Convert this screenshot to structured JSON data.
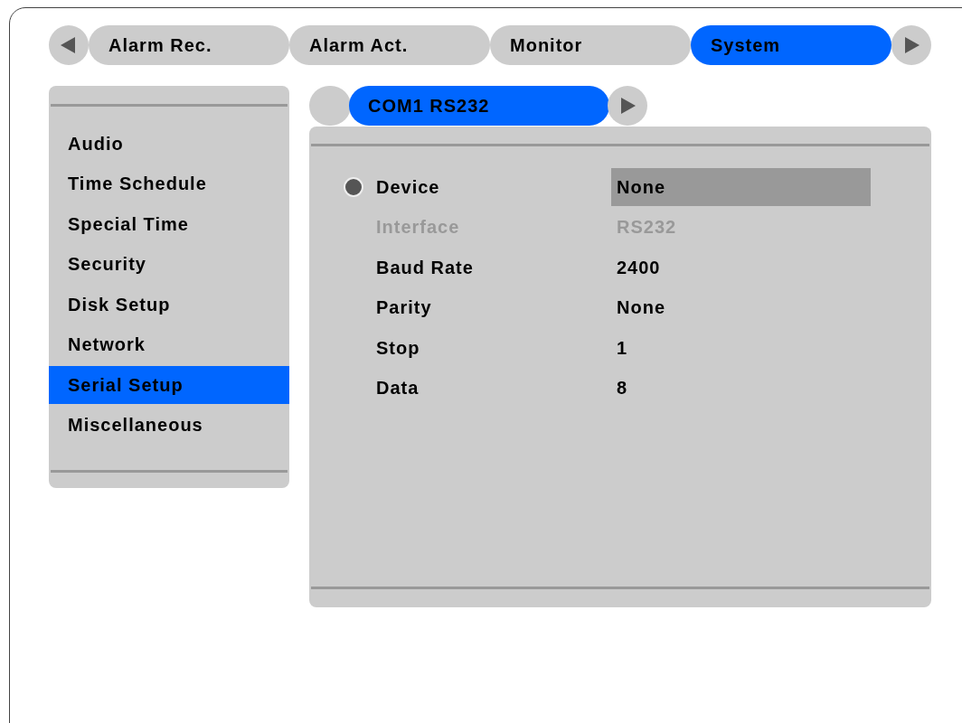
{
  "tabs": [
    {
      "label": "Alarm Rec.",
      "selected": false
    },
    {
      "label": "Alarm Act.",
      "selected": false
    },
    {
      "label": "Monitor",
      "selected": false
    },
    {
      "label": "System",
      "selected": true
    }
  ],
  "sidebar": {
    "items": [
      {
        "label": "Audio",
        "selected": false
      },
      {
        "label": "Time Schedule",
        "selected": false
      },
      {
        "label": "Special Time",
        "selected": false
      },
      {
        "label": "Security",
        "selected": false
      },
      {
        "label": "Disk Setup",
        "selected": false
      },
      {
        "label": "Network",
        "selected": false
      },
      {
        "label": "Serial Setup",
        "selected": true
      },
      {
        "label": "Miscellaneous",
        "selected": false
      }
    ]
  },
  "sub_tab": {
    "label": "COM1 RS232",
    "selected": true
  },
  "settings": [
    {
      "label": "Device",
      "value": "None",
      "focused": true,
      "disabled": false
    },
    {
      "label": "Interface",
      "value": "RS232",
      "focused": false,
      "disabled": true
    },
    {
      "label": "Baud Rate",
      "value": "2400",
      "focused": false,
      "disabled": false
    },
    {
      "label": "Parity",
      "value": "None",
      "focused": false,
      "disabled": false
    },
    {
      "label": "Stop",
      "value": "1",
      "focused": false,
      "disabled": false
    },
    {
      "label": "Data",
      "value": "8",
      "focused": false,
      "disabled": false
    }
  ]
}
